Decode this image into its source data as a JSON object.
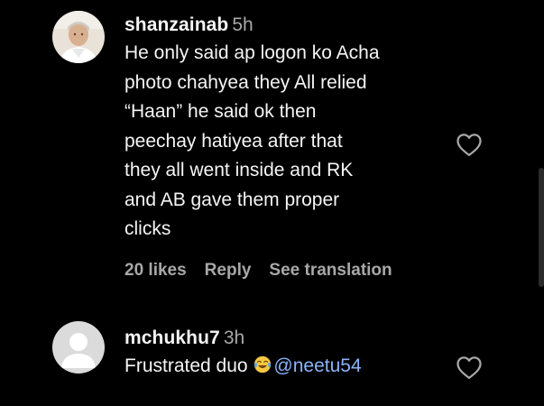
{
  "comments": [
    {
      "username": "shanzainab",
      "time": "5h",
      "lines": [
        "He only said ap logon ko Acha",
        "photo chahyea they All relied",
        "“Haan” he said ok then",
        "peechay hatiyea after that",
        "they all went inside and RK",
        "and AB gave them proper",
        "clicks"
      ],
      "likes": "20 likes",
      "reply": "Reply",
      "see_translation": "See translation",
      "avatar_icon": "user-photo-avatar",
      "like_icon": "heart-outline-icon"
    },
    {
      "username": "mchukhu7",
      "time": "3h",
      "text": "Frustrated duo ",
      "emoji_icon": "face-with-tears-of-joy-icon",
      "mention": "@neetu54",
      "avatar_icon": "default-avatar",
      "like_icon": "heart-outline-icon"
    }
  ],
  "colors": {
    "background": "#000000",
    "primary_text": "#f5f5f5",
    "secondary_text": "#a8a8a8",
    "mention": "#8ab4f8"
  }
}
